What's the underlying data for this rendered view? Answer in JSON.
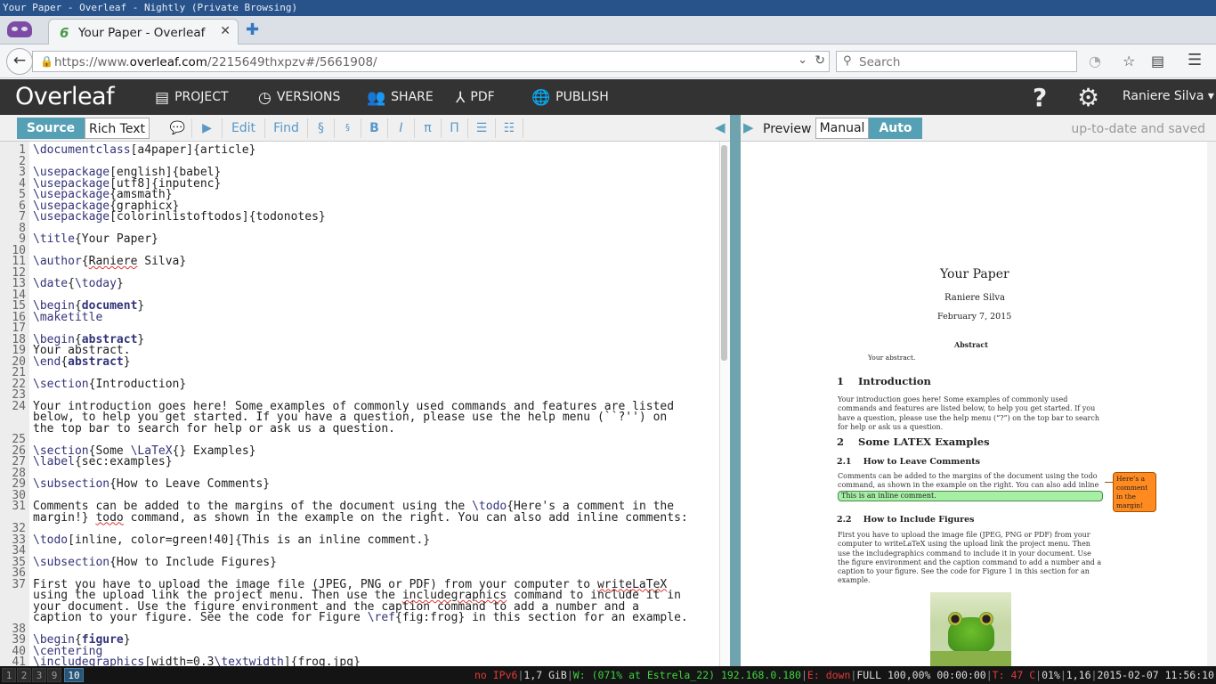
{
  "window_title": "Your Paper - Overleaf - Nightly (Private Browsing)",
  "browser": {
    "tab_title": "Your Paper - Overleaf",
    "tab_favicon": "6",
    "url_prefix": "https://www.",
    "url_host": "overleaf.com",
    "url_path": "/2215649thxpzv#/5661908/",
    "search_placeholder": "Search",
    "icons": [
      "private-browsing-icon",
      "back-icon",
      "lock-icon",
      "dropdown-icon",
      "reload-icon",
      "search-icon",
      "rss-icon",
      "star-icon",
      "reading-list-icon",
      "menu-icon"
    ]
  },
  "overleaf": {
    "logo": "Overleaf",
    "nav": {
      "project": "PROJECT",
      "versions": "VERSIONS",
      "share": "SHARE",
      "pdf": "PDF",
      "publish": "PUBLISH"
    },
    "help": "?",
    "user": "Raniere Silva"
  },
  "editor_toolbar": {
    "source": "Source",
    "rich_text": "Rich Text",
    "edit": "Edit",
    "find": "Find",
    "section": "§",
    "subsection": "§",
    "bold": "B",
    "italic": "I",
    "pi": "π",
    "Pi": "Π"
  },
  "preview_toolbar": {
    "preview": "Preview",
    "manual": "Manual",
    "auto": "Auto",
    "status": "up-to-date and saved"
  },
  "pdf": {
    "title": "Your Paper",
    "author": "Raniere Silva",
    "date": "February 7, 2015",
    "abstract_head": "Abstract",
    "abstract_body": "Your abstract.",
    "s1": "1    Introduction",
    "s1_body": "Your introduction goes here! Some examples of commonly used commands and features are listed below, to help you get started. If you have a question, please use the help menu (“?”) on the top bar to search for help or ask us a question.",
    "s2": "2    Some LATEX Examples",
    "s21": "2.1    How to Leave Comments",
    "s21_body": "Comments can be added to the margins of the document using the todo command, as shown in the example on the right. You can also add inline comments:",
    "inline_todo": "This is an inline comment.",
    "margin_todo": "Here’s a comment in the margin!",
    "s22": "2.2    How to Include Figures",
    "s22_body": "First you have to upload the image file (JPEG, PNG or PDF) from your computer to writeLaTeX using the upload link the project menu. Then use the includegraphics command to include it in your document. Use the figure environment and the caption command to add a number and a caption to your figure. See the code for Figure 1 in this section for an example."
  },
  "statusbar": {
    "workspaces": [
      "1",
      "2",
      "3",
      "9",
      "10"
    ],
    "active_workspace": "10",
    "ipv6": "no IPv6",
    "mem": "1,7 GiB",
    "wifi": "W: (071% at Estrela_22) 192.168.0.180",
    "eth": "E: down",
    "battery": "FULL 100,00% 00:00:00",
    "temp": "T: 47 C",
    "cpu": "01%",
    "load": "1,16",
    "datetime": "2015-02-07 11:56:10"
  }
}
